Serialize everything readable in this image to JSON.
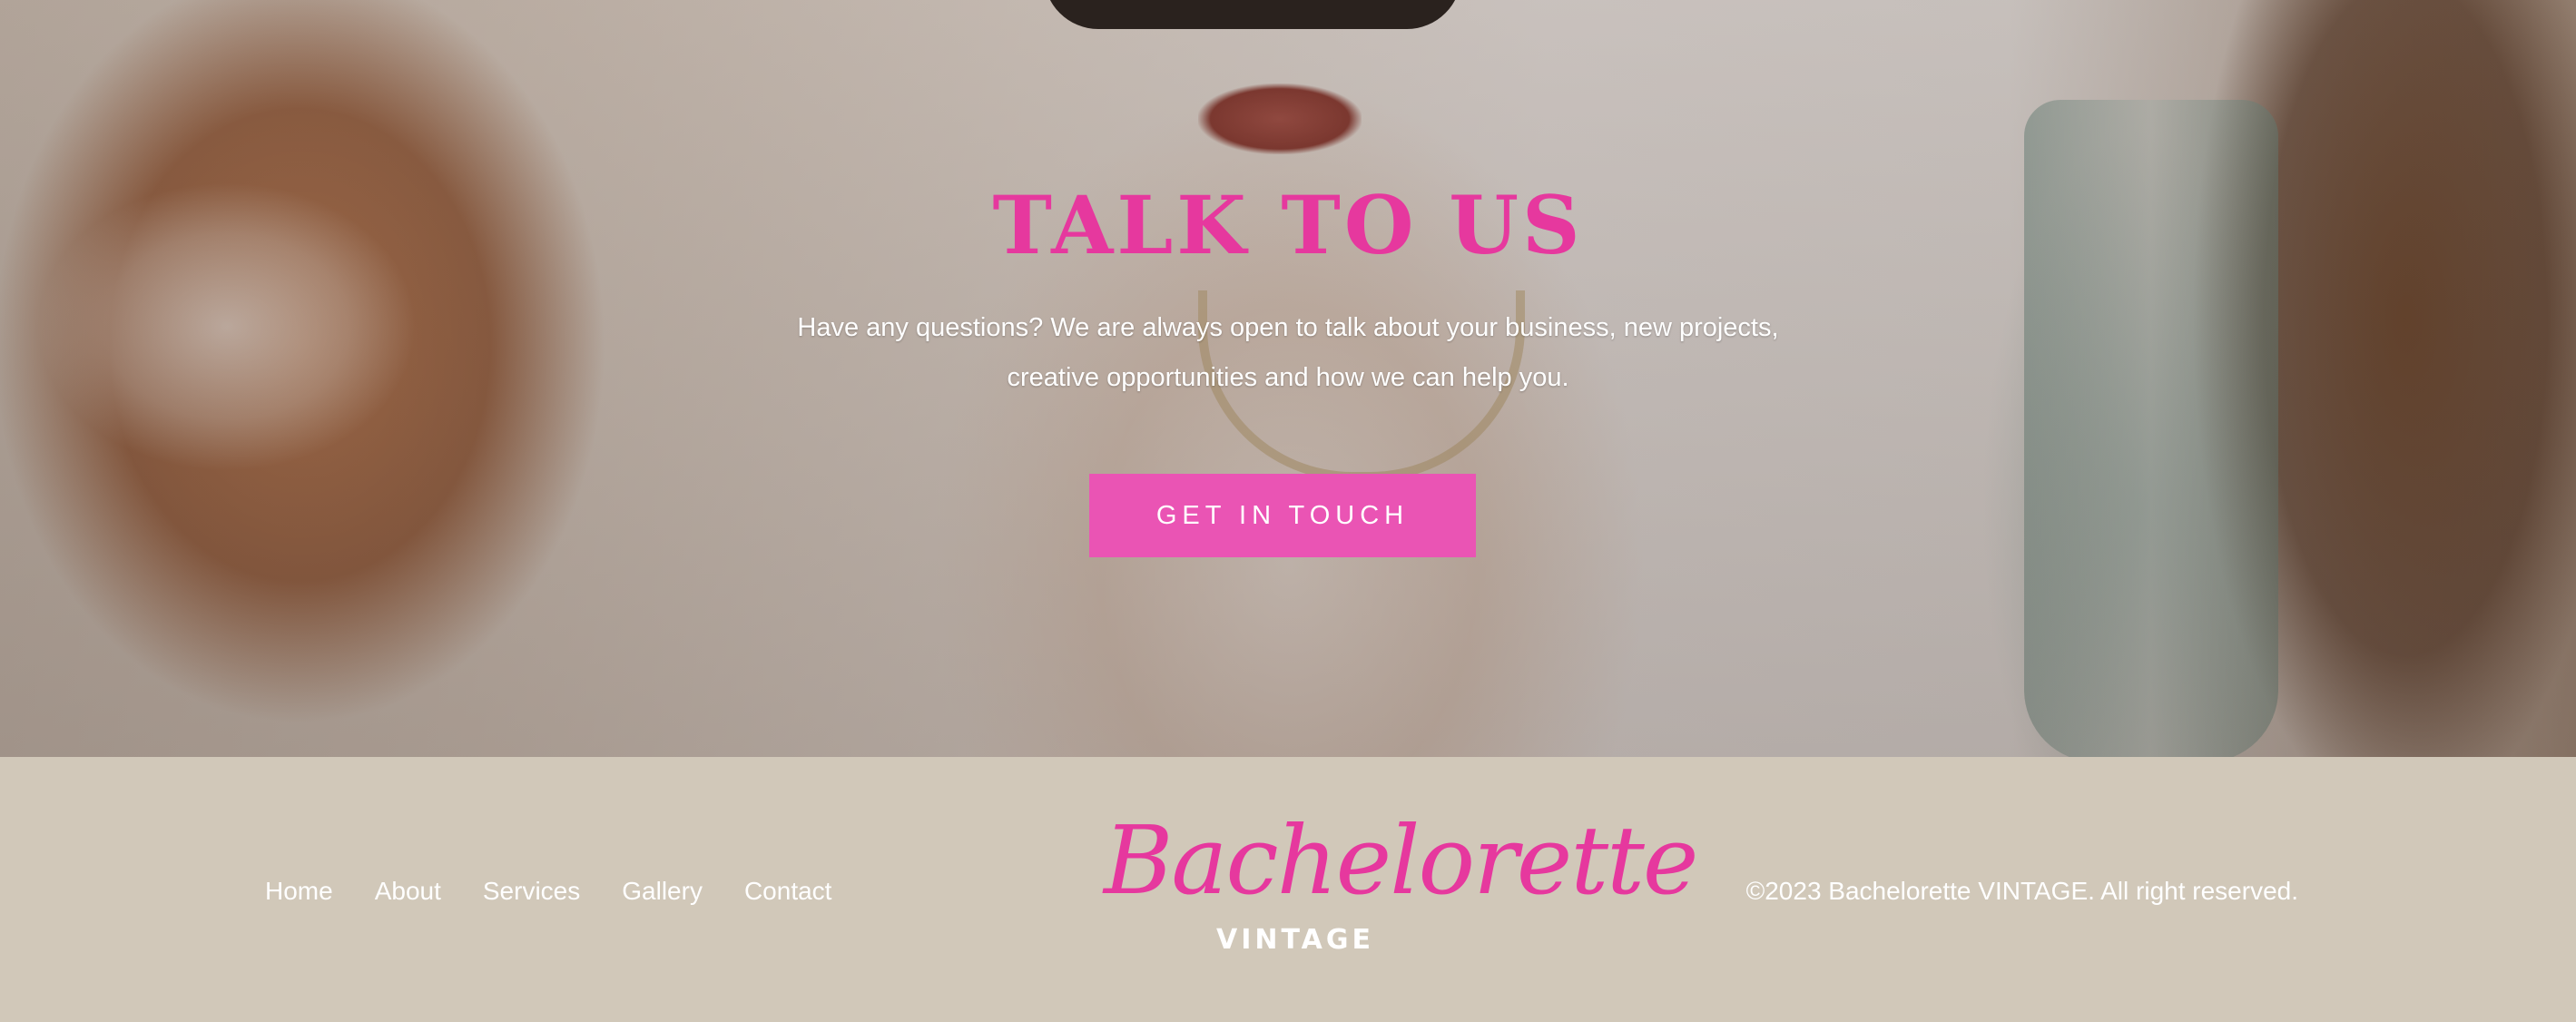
{
  "hero": {
    "title": "TALK TO US",
    "subtitle_line1": "Have any questions? We are always open to talk about your business, new projects,",
    "subtitle_line2": "creative opportunities and how we can help you.",
    "cta_label": "GET IN TOUCH",
    "background_image": "woman in satin robe with sunglasses and pearl necklace"
  },
  "footer": {
    "nav": [
      "Home",
      "About",
      "Services",
      "Gallery",
      "Contact"
    ],
    "logo_script": "Bachelorette",
    "logo_sub": "VINTAGE",
    "copyright": "©2023 Bachelorette VINTAGE. All right reserved."
  },
  "colors": {
    "accent": "#e6389e",
    "button": "#ea54b4",
    "footer_bg": "#d1c8b9",
    "text_light": "#ffffff"
  }
}
